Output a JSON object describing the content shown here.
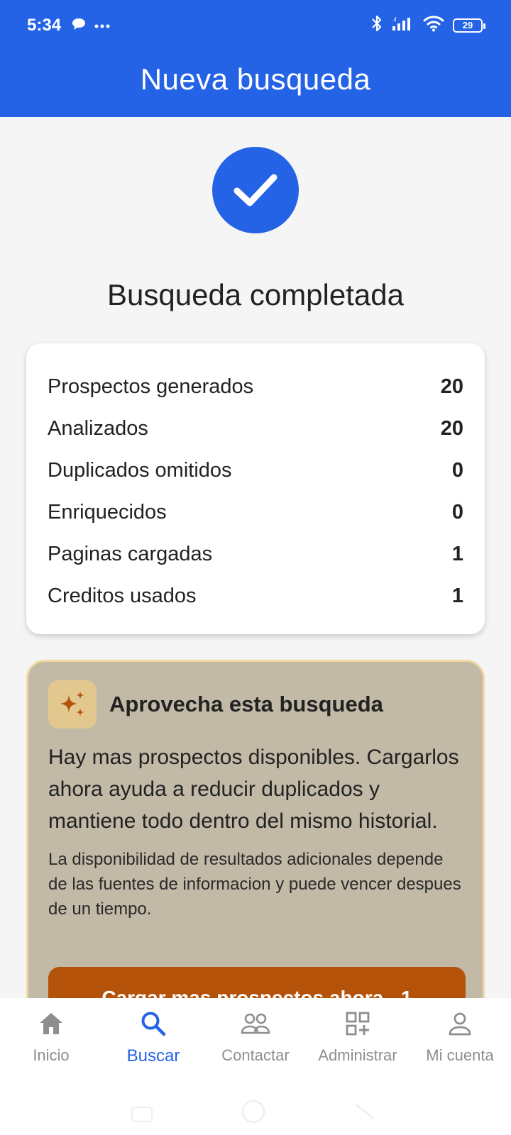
{
  "status_bar": {
    "time": "5:34",
    "battery": "29",
    "icons": [
      "chat-bubble-icon",
      "more-dots-icon",
      "bluetooth-icon",
      "signal-icon",
      "wifi-icon",
      "battery-icon"
    ]
  },
  "header": {
    "title": "Nueva busqueda"
  },
  "result": {
    "title": "Busqueda completada",
    "icon": "check-icon",
    "accent": "#2563e6"
  },
  "stats": [
    {
      "label": "Prospectos generados",
      "value": "20"
    },
    {
      "label": "Analizados",
      "value": "20"
    },
    {
      "label": "Duplicados omitidos",
      "value": "0"
    },
    {
      "label": "Enriquecidos",
      "value": "0"
    },
    {
      "label": "Paginas cargadas",
      "value": "1"
    },
    {
      "label": "Creditos usados",
      "value": "1"
    }
  ],
  "promo": {
    "icon": "sparkles-icon",
    "title": "Aprovecha esta busqueda",
    "body": "Hay mas prospectos disponibles. Cargarlos ahora ayuda a reducir duplicados y mantiene todo dentro del mismo historial.",
    "note": "La disponibilidad de resultados adicionales depende de las fuentes de informacion y puede vencer despues de un tiempo.",
    "button_label": "Cargar mas prospectos ahora - 1",
    "button_color": "#b5520a"
  },
  "nav": {
    "items": [
      {
        "label": "Inicio",
        "icon": "home-icon"
      },
      {
        "label": "Buscar",
        "icon": "search-icon",
        "active": true
      },
      {
        "label": "Contactar",
        "icon": "people-icon"
      },
      {
        "label": "Administrar",
        "icon": "grid-add-icon"
      },
      {
        "label": "Mi cuenta",
        "icon": "person-icon"
      }
    ]
  }
}
